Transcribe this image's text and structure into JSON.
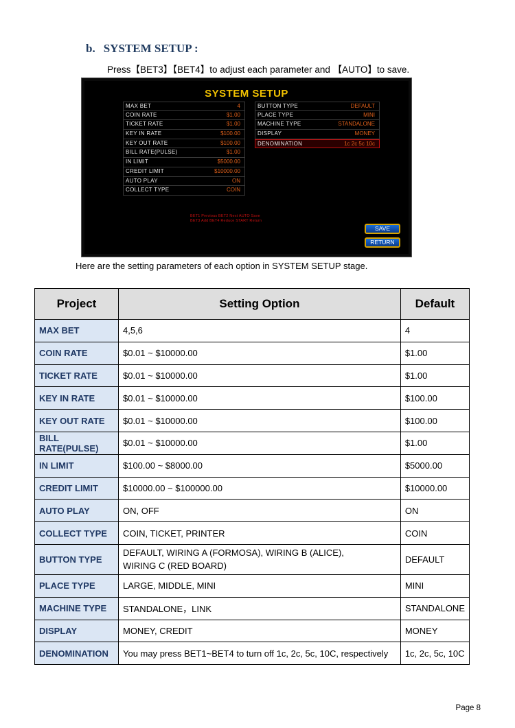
{
  "section": {
    "index": "b.",
    "title": "SYSTEM SETUP :"
  },
  "intro": "Press【BET3】【BET4】to adjust each parameter and 【AUTO】to save.",
  "screen": {
    "title": "SYSTEM SETUP",
    "left_items": [
      {
        "key": "MAX BET",
        "value": "4"
      },
      {
        "key": "COIN RATE",
        "value": "$1.00"
      },
      {
        "key": "TICKET RATE",
        "value": "$1.00"
      },
      {
        "key": "KEY IN RATE",
        "value": "$100.00"
      },
      {
        "key": "KEY OUT RATE",
        "value": "$100.00"
      },
      {
        "key": "BILL RATE(PULSE)",
        "value": "$1.00"
      },
      {
        "key": "IN LIMIT",
        "value": "$5000.00"
      },
      {
        "key": "CREDIT LIMIT",
        "value": "$10000.00"
      },
      {
        "key": "AUTO PLAY",
        "value": "ON"
      },
      {
        "key": "COLLECT TYPE",
        "value": "COIN"
      }
    ],
    "right_items": [
      {
        "key": "BUTTON TYPE",
        "value": "DEFAULT"
      },
      {
        "key": "PLACE TYPE",
        "value": "MINI"
      },
      {
        "key": "MACHINE TYPE",
        "value": "STANDALONE"
      },
      {
        "key": "DISPLAY",
        "value": "MONEY"
      },
      {
        "key": "DENOMINATION",
        "value": "1c 2c 5c 10c"
      }
    ],
    "hint_line1": "BET1 Previous    BET2 Next    AUTO Save",
    "hint_line2": "BET3 Add    BET4 Reduce    START Return",
    "save_label": "SAVE",
    "return_label": "RETURN"
  },
  "caption": "Here are the setting parameters of each option in SYSTEM SETUP stage.",
  "table": {
    "headers": [
      "Project",
      "Setting Option",
      "Default"
    ],
    "rows": [
      {
        "project": "MAX BET",
        "option": "4,5,6",
        "default": "4"
      },
      {
        "project": "COIN RATE",
        "option": "$0.01 ~ $10000.00",
        "default": "$1.00"
      },
      {
        "project": "TICKET RATE",
        "option": "$0.01 ~ $10000.00",
        "default": "$1.00"
      },
      {
        "project": "KEY IN RATE",
        "option": "$0.01 ~ $10000.00",
        "default": "$100.00"
      },
      {
        "project": "KEY OUT RATE",
        "option": "$0.01 ~ $10000.00",
        "default": "$100.00"
      },
      {
        "project": "BILL RATE(PULSE)",
        "option": "$0.01 ~ $10000.00",
        "default": "$1.00"
      },
      {
        "project": "IN LIMIT",
        "option": "$100.00 ~ $8000.00",
        "default": "$5000.00"
      },
      {
        "project": "CREDIT LIMIT",
        "option": "$10000.00 ~ $100000.00",
        "default": "$10000.00"
      },
      {
        "project": "AUTO PLAY",
        "option": "ON, OFF",
        "default": "ON"
      },
      {
        "project": "COLLECT TYPE",
        "option": "COIN, TICKET, PRINTER",
        "default": "COIN"
      },
      {
        "project": "BUTTON TYPE",
        "option_lines": [
          "DEFAULT, WIRING A (FORMOSA), WIRING B (ALICE),",
          "WIRING C (RED BOARD)"
        ],
        "default": "DEFAULT"
      },
      {
        "project": "PLACE TYPE",
        "option": "LARGE, MIDDLE, MINI",
        "default": "MINI"
      },
      {
        "project": "MACHINE TYPE",
        "option": "STANDALONE，LINK",
        "default": "STANDALONE"
      },
      {
        "project": "DISPLAY",
        "option": "MONEY, CREDIT",
        "default": "MONEY"
      },
      {
        "project": "DENOMINATION",
        "option": "You may press BET1~BET4 to turn off 1c, 2c, 5c, 10C, respectively",
        "default": "1c, 2c, 5c, 10C"
      }
    ]
  },
  "footer": {
    "page": "Page  8"
  }
}
